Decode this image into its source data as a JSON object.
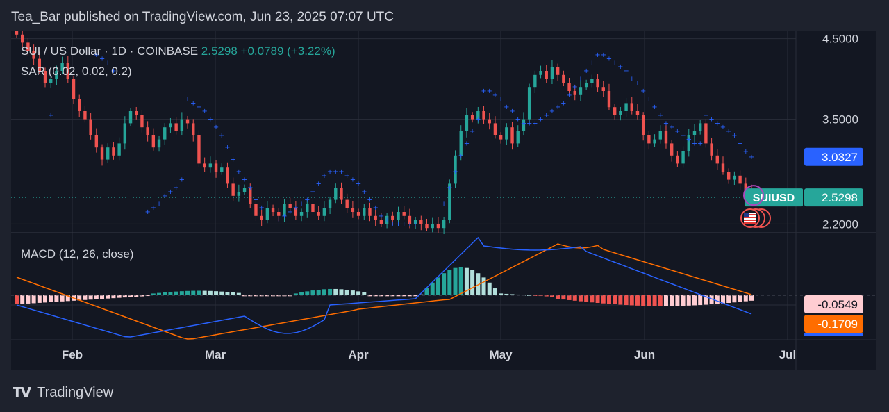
{
  "publish_line": "Tea_Bar published on TradingView.com, Jun 23, 2025 07:07 UTC",
  "brand": {
    "mark": "TV",
    "name": "TradingView"
  },
  "legend": {
    "symbol_line": "SUI / US Dollar · 1D · COINBASE",
    "price": "2.5298",
    "change": "+0.0789 (+3.22%)",
    "sar": "SAR (0.02, 0.02, 0.2)",
    "macd": "MACD (12, 26, close)"
  },
  "colors": {
    "up": "#26a69a",
    "down": "#ef5350",
    "sar": "#2962ff",
    "macd_line": "#2962ff",
    "signal_line": "#ff6d00",
    "hist_pos_strong": "#26a69a",
    "hist_pos_weak": "#b2dfdb",
    "hist_neg_strong": "#ef5350",
    "hist_neg_weak": "#ffcdd2",
    "grid": "#2a2e39",
    "text": "#d1d4dc"
  },
  "chart_data": {
    "type": "candlestick",
    "title": "SUI / US Dollar · 1D · COINBASE",
    "price_axis": {
      "ticks": [
        "4.5000",
        "3.5000",
        "2.2000"
      ],
      "range": [
        2.1,
        4.6
      ]
    },
    "x_axis": {
      "ticks": [
        "Feb",
        "Mar",
        "Apr",
        "May",
        "Jun",
        "Jul"
      ]
    },
    "last_price": {
      "label": "SUIUSD",
      "value": "2.5298"
    },
    "sar_price": {
      "value": "3.0327"
    },
    "close": [
      4.55,
      4.45,
      4.35,
      4.25,
      4.1,
      3.95,
      4.0,
      4.1,
      4.2,
      4.0,
      3.75,
      3.6,
      3.5,
      3.3,
      3.15,
      3.0,
      3.15,
      3.05,
      3.2,
      3.45,
      3.6,
      3.55,
      3.4,
      3.3,
      3.15,
      3.25,
      3.4,
      3.45,
      3.35,
      3.5,
      3.45,
      3.3,
      2.95,
      2.9,
      2.95,
      2.85,
      2.9,
      2.7,
      2.55,
      2.6,
      2.65,
      2.45,
      2.3,
      2.25,
      2.4,
      2.35,
      2.3,
      2.45,
      2.4,
      2.3,
      2.35,
      2.45,
      2.35,
      2.3,
      2.4,
      2.5,
      2.65,
      2.5,
      2.4,
      2.35,
      2.3,
      2.4,
      2.3,
      2.25,
      2.2,
      2.3,
      2.25,
      2.35,
      2.3,
      2.2,
      2.25,
      2.2,
      2.15,
      2.2,
      2.15,
      2.25,
      2.7,
      3.05,
      3.35,
      3.55,
      3.5,
      3.6,
      3.5,
      3.45,
      3.3,
      3.25,
      3.4,
      3.2,
      3.35,
      3.5,
      3.9,
      4.05,
      4.1,
      4.0,
      4.15,
      4.05,
      3.95,
      3.85,
      3.8,
      3.9,
      3.95,
      4.0,
      3.9,
      3.85,
      3.65,
      3.55,
      3.6,
      3.7,
      3.6,
      3.55,
      3.3,
      3.2,
      3.25,
      3.35,
      3.2,
      3.05,
      2.95,
      3.1,
      3.3,
      3.35,
      3.45,
      3.2,
      3.05,
      2.95,
      2.85,
      2.75,
      2.8,
      2.7,
      2.6,
      2.53
    ],
    "sar": [
      null,
      null,
      null,
      null,
      null,
      null,
      3.55,
      null,
      null,
      null,
      null,
      null,
      null,
      null,
      4.3,
      4.25,
      4.2,
      4.1,
      4.0,
      null,
      null,
      null,
      null,
      2.35,
      2.4,
      2.45,
      2.55,
      2.6,
      2.65,
      2.75,
      3.75,
      3.7,
      3.65,
      3.6,
      3.5,
      3.4,
      3.3,
      3.15,
      3.0,
      2.85,
      2.75,
      2.65,
      2.5,
      2.4,
      null,
      null,
      2.25,
      2.3,
      2.35,
      2.4,
      2.45,
      2.5,
      2.6,
      2.7,
      2.8,
      2.85,
      2.85,
      2.85,
      2.8,
      2.75,
      2.7,
      2.6,
      2.5,
      2.4,
      2.3,
      2.25,
      2.2,
      2.2,
      2.2,
      2.2,
      2.2,
      null,
      null,
      null,
      null,
      2.45,
      2.65,
      2.85,
      3.05,
      3.2,
      3.35,
      3.5,
      3.85,
      3.85,
      3.8,
      3.75,
      3.65,
      3.6,
      3.5,
      3.45,
      3.45,
      3.45,
      3.5,
      3.55,
      3.6,
      3.65,
      3.7,
      3.8,
      3.9,
      4.0,
      4.1,
      4.2,
      4.3,
      4.3,
      4.25,
      4.2,
      4.15,
      4.1,
      4.0,
      3.95,
      3.85,
      3.75,
      3.65,
      3.55,
      3.45,
      3.4,
      3.35,
      3.3,
      3.25,
      3.2,
      3.2,
      3.55,
      3.5,
      3.45,
      3.4,
      3.35,
      3.3,
      3.2,
      3.1,
      3.03,
      null
    ],
    "macd": {
      "params": "12, 26, close",
      "macd_value": "-0.0549",
      "signal_value": "-0.1709"
    }
  }
}
